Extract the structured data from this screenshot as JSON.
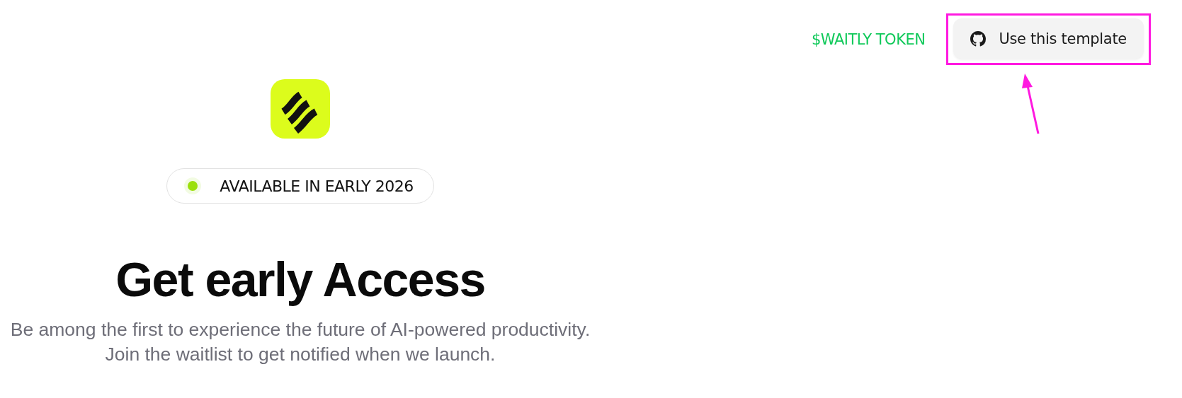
{
  "header": {
    "token_link": "$WAITLY TOKEN",
    "template_button": "Use this template"
  },
  "badge": {
    "text": "AVAILABLE IN EARLY 2026",
    "color": "#9be00a"
  },
  "hero": {
    "title": "Get early Access",
    "subtitle": "Be among the first to experience the future of AI-powered productivity. Join the waitlist to get notified when we launch."
  }
}
